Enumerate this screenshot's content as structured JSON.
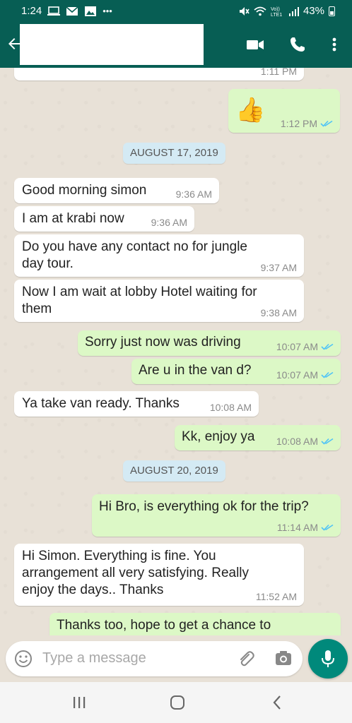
{
  "status": {
    "time": "1:24",
    "battery": "43%",
    "left_icons": [
      "laptop-icon",
      "mail-icon",
      "image-icon",
      "more-dots-icon"
    ],
    "right_icons": [
      "mute-icon",
      "wifi-icon",
      "volte-icon",
      "signal-icon",
      "battery-icon"
    ],
    "volte_text": "Vo))\nLTE1"
  },
  "appbar": {
    "contact_name": "",
    "icons": [
      "back-arrow-icon",
      "video-call-icon",
      "voice-call-icon",
      "more-vertical-icon"
    ],
    "color": "#075e54"
  },
  "chat": {
    "partial_top_time": "1:11 PM",
    "thumbs_time": "1:12 PM",
    "thumbs_emoji": "👍",
    "date1": "AUGUST 17, 2019",
    "date2": "AUGUST 20, 2019",
    "messages": [
      {
        "dir": "in",
        "text": "Good morning simon",
        "time": "9:36 AM"
      },
      {
        "dir": "in",
        "text": "I am at krabi now",
        "time": "9:36 AM"
      },
      {
        "dir": "in",
        "text": "Do you have any contact no for jungle day tour.",
        "time": "9:37 AM"
      },
      {
        "dir": "in",
        "text": "Now I am wait at lobby Hotel waiting for them",
        "time": "9:38 AM"
      },
      {
        "dir": "out",
        "text": "Sorry just now was driving",
        "time": "10:07 AM"
      },
      {
        "dir": "out",
        "text": "Are u in the van d?",
        "time": "10:07 AM"
      },
      {
        "dir": "in",
        "text": "Ya take van ready. Thanks",
        "time": "10:08 AM"
      },
      {
        "dir": "out",
        "text": "Kk, enjoy ya",
        "time": "10:08 AM"
      },
      {
        "dir": "out",
        "text": "Hi Bro, is everything ok for the trip?",
        "time": "11:14 AM"
      },
      {
        "dir": "in",
        "text": "Hi Simon. Everything is fine. You arrangement all very satisfying. Really enjoy the days.. Thanks",
        "time": "11:52 AM"
      },
      {
        "dir": "out",
        "text": "Thanks too, hope to get a chance to",
        "time": ""
      }
    ],
    "colors": {
      "incoming": "#ffffff",
      "outgoing": "#dcf8c6",
      "read_tick": "#4fc3f7",
      "date_chip": "#d4eaf4"
    }
  },
  "input": {
    "placeholder": "Type a message",
    "icons": [
      "emoji-icon",
      "attach-icon",
      "camera-icon",
      "mic-icon"
    ]
  },
  "navbar": {
    "icons": [
      "recent-apps-icon",
      "home-icon",
      "back-icon"
    ]
  }
}
